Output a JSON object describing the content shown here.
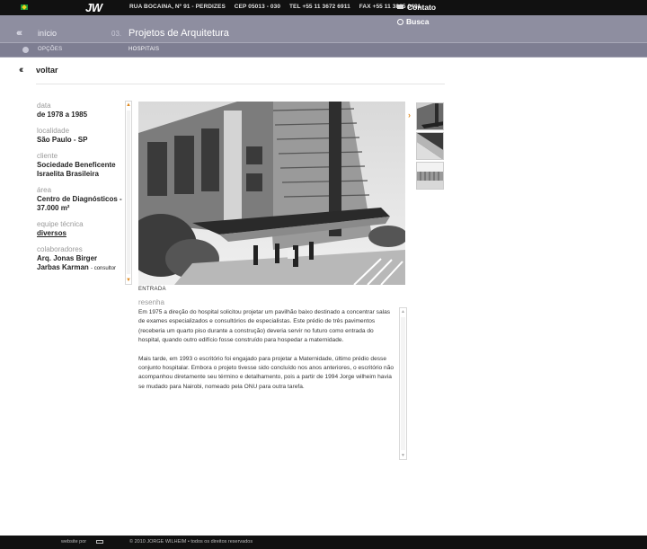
{
  "topbar": {
    "logo": "JW",
    "address": "RUA BOCAINA, Nº 91 - PERDIZES",
    "cep": "CEP 05013 - 030",
    "tel": "TEL +55 11 3672 6911",
    "fax": "FAX +55 11 3865 0491",
    "contato": "Contato"
  },
  "nav": {
    "busca": "Busca",
    "inicio": "início",
    "section_number": "03.",
    "section_title": "Projetos de Arquitetura"
  },
  "subnav": {
    "opcoes": "OPÇÕES",
    "current": "HOSPITAIS"
  },
  "voltar": "voltar",
  "info": {
    "data_label": "data",
    "data_value": "de 1978 a 1985",
    "localidade_label": "localidade",
    "localidade_value": "São Paulo - SP",
    "cliente_label": "cliente",
    "cliente_value_1": "Sociedade Beneficente",
    "cliente_value_2": "Israelita Brasileira",
    "area_label": "área",
    "area_value_1": "Centro de Diagnósticos -",
    "area_value_2": "37.000 m²",
    "equipe_label": "equipe técnica",
    "equipe_value": "diversos",
    "colab_label": "colaboradores",
    "colab_1": "Arq. Jonas Birger",
    "colab_2": "Jarbas Karman",
    "colab_2_role": "- consultor"
  },
  "photo_caption": "ENTRADA",
  "resenha": {
    "label": "resenha",
    "p1": "Em 1975 a direção do hospital solicitou projetar um pavilhão baixo destinado a concentrar salas de exames especializados e consultórios de especialistas. Este prédio de três pavimentos (receberia um quarto piso durante a construção) deveria servir no futuro como entrada do hospital, quando outro edifício fosse construído para hospedar a maternidade.",
    "p2": "Mais tarde, em 1993 o escritório foi engajado para projetar a Maternidade, último prédio desse conjunto hospitalar. Embora o projeto tivesse sido concluído nos anos anteriores, o escritório não acompanhou diretamente seu término e detalhamento, pois a partir de 1994 Jorge wilheim havia se mudado para Nairobi, nomeado pela ONU para outra tarefa."
  },
  "footer": {
    "website_por": "website por",
    "copyright": "© 2010 JORGE WILHEIM • todos os direitos reservados"
  },
  "colors": {
    "nav_bg": "#8e8ea0",
    "subnav_bg": "#7e7e92",
    "accent": "#e08a20",
    "topbar_bg": "#111111"
  }
}
